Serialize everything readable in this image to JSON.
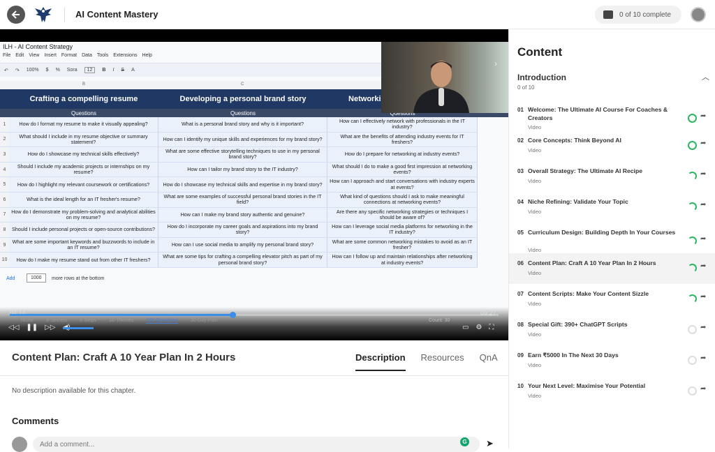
{
  "header": {
    "title": "AI Content Mastery",
    "progress": "0 of 10 complete"
  },
  "video": {
    "sheet_title": "ILH - AI Content Strategy",
    "sheet_menu": [
      "File",
      "Edit",
      "View",
      "Insert",
      "Format",
      "Data",
      "Tools",
      "Extensions",
      "Help"
    ],
    "toolbar": {
      "zoom": "100%",
      "font": "Sora",
      "size": "12"
    },
    "col_letters": [
      "B",
      "C"
    ],
    "headers": [
      "Crafting a compelling resume",
      "Developing a personal brand story",
      "Networking"
    ],
    "subheaders": [
      "Questions",
      "Questions",
      "Questions"
    ],
    "rows": [
      [
        "1",
        "How do I format my resume to make it visually appealing?",
        "What is a personal brand story and why is it important?",
        "How can I effectively network with professionals in the IT industry?"
      ],
      [
        "2",
        "What should I include in my resume objective or summary statement?",
        "How can I identify my unique skills and experiences for my brand story?",
        "What are the benefits of attending industry events for IT freshers?"
      ],
      [
        "3",
        "How do I showcase my technical skills effectively?",
        "What are some effective storytelling techniques to use in my personal brand story?",
        "How do I prepare for networking at industry events?"
      ],
      [
        "4",
        "Should I include my academic projects or internships on my resume?",
        "How can I tailor my brand story to the IT industry?",
        "What should I do to make a good first impression at networking events?"
      ],
      [
        "5",
        "How do I highlight my relevant coursework or certifications?",
        "How do I showcase my technical skills and expertise in my brand story?",
        "How can I approach and start conversations with industry experts at events?"
      ],
      [
        "6",
        "What is the ideal length for an IT fresher's resume?",
        "What are some examples of successful personal brand stories in the IT field?",
        "What kind of questions should I ask to make meaningful connections at networking events?"
      ],
      [
        "7",
        "How do I demonstrate my problem-solving and analytical abilities on my resume?",
        "How can I make my brand story authentic and genuine?",
        "Are there any specific networking strategies or techniques I should be aware of?"
      ],
      [
        "8",
        "Should I include personal projects or open-source contributions?",
        "How do I incorporate my career goals and aspirations into my brand story?",
        "How can I leverage social media platforms for networking in the IT industry?"
      ],
      [
        "9",
        "What are some important keywords and buzzwords to include in an IT resume?",
        "How can I use social media to amplify my personal brand story?",
        "What are some common networking mistakes to avoid as an IT fresher?"
      ],
      [
        "10",
        "How do I make my resume stand out from other IT freshers?",
        "What are some tips for crafting a compelling elevator pitch as part of my personal brand story?",
        "How can I follow up and maintain relationships after networking at industry events?"
      ]
    ],
    "add_label": "Add",
    "add_value": "1000",
    "add_suffix": "more rows at the bottom",
    "time_current": "04:14",
    "time_total": "09:27",
    "progress_fraction": 0.455,
    "volume_fraction": 1.0,
    "sheet_tabs": [
      "Niche",
      "3-Secrets",
      "6-Steps",
      "10-Themes",
      "100-Questions",
      "30-Day Plan"
    ],
    "active_tab": "100-Questions",
    "count": "Count: 30",
    "accent": "#3b8ee8"
  },
  "chapter": {
    "title": "Content Plan: Craft A 10 Year Plan In 2 Hours",
    "tabs": [
      "Description",
      "Resources",
      "QnA"
    ],
    "active_tab": "Description",
    "description": "No description available for this chapter.",
    "comments_title": "Comments",
    "comment_placeholder": "Add a comment..."
  },
  "sidebar": {
    "title": "Content",
    "section": "Introduction",
    "section_count": "0 of 10",
    "lessons": [
      {
        "num": "01",
        "name": "Welcome: The Ultimate AI Course For Coaches & Creators",
        "type": "Video",
        "status": "full"
      },
      {
        "num": "02",
        "name": "Core Concepts: Think Beyond AI",
        "type": "Video",
        "status": "full"
      },
      {
        "num": "03",
        "name": "Overall Strategy: The Ultimate AI Recipe",
        "type": "Video",
        "status": "part"
      },
      {
        "num": "04",
        "name": "Niche Refining: Validate Your Topic",
        "type": "Video",
        "status": "part"
      },
      {
        "num": "05",
        "name": "Curriculum Design: Building Depth In Your Courses",
        "type": "Video",
        "status": "part"
      },
      {
        "num": "06",
        "name": "Content Plan: Craft A 10 Year Plan In 2 Hours",
        "type": "Video",
        "status": "part",
        "active": true
      },
      {
        "num": "07",
        "name": "Content Scripts: Make Your Content Sizzle",
        "type": "Video",
        "status": "part"
      },
      {
        "num": "08",
        "name": "Special Gift: 390+ ChatGPT Scripts",
        "type": "Video",
        "status": "empty"
      },
      {
        "num": "09",
        "name": "Earn ₹5000 In The Next 30 Days",
        "type": "Video",
        "status": "empty"
      },
      {
        "num": "10",
        "name": "Your Next Level: Maximise Your Potential",
        "type": "Video",
        "status": "empty"
      }
    ]
  }
}
